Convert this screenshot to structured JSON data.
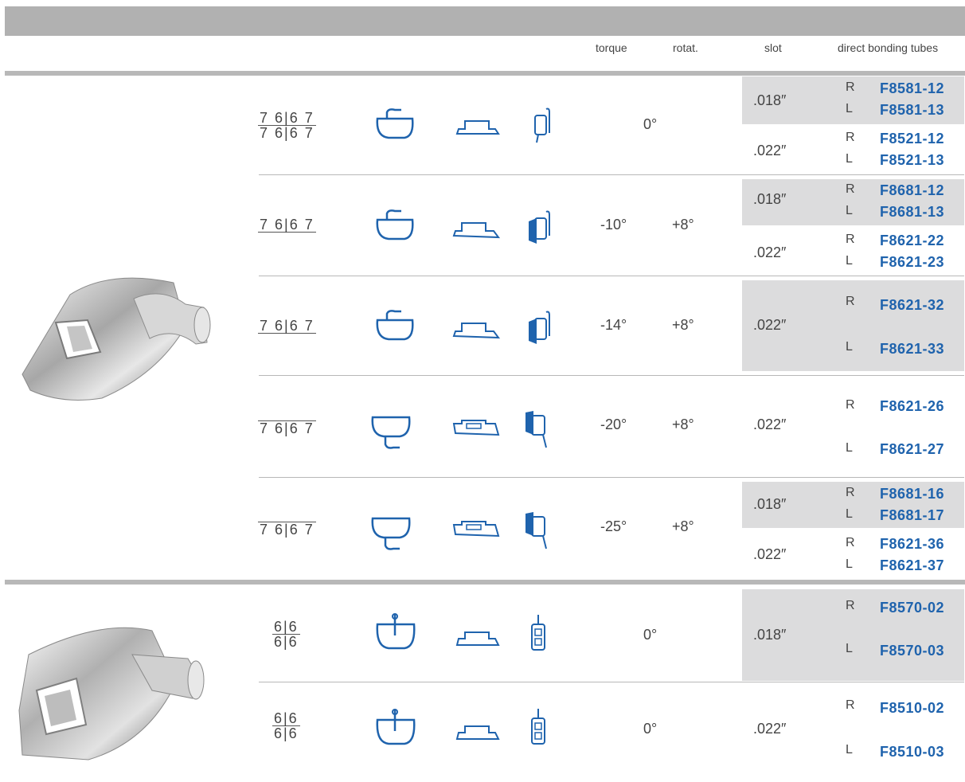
{
  "headers": {
    "torque": "torque",
    "rotat": "rotat.",
    "slot": "slot",
    "tubes": "direct bonding tubes"
  },
  "groups": [
    {
      "rows": [
        {
          "teeth_top": "7 6|6 7",
          "teeth_bottom": "7 6|6 7",
          "torque": "0°",
          "rotation": "",
          "slots": [
            {
              "slot": ".018″",
              "R": "F8581-12",
              "L": "F8581-13"
            },
            {
              "slot": ".022″",
              "R": "F8521-12",
              "L": "F8521-13"
            }
          ]
        },
        {
          "teeth_top": "7 6|6 7",
          "torque": "-10°",
          "rotation": "+8°",
          "slots": [
            {
              "slot": ".018″",
              "R": "F8681-12",
              "L": "F8681-13"
            },
            {
              "slot": ".022″",
              "R": "F8621-22",
              "L": "F8621-23"
            }
          ]
        },
        {
          "teeth_top": "7 6|6 7",
          "torque": "-14°",
          "rotation": "+8°",
          "slots": [
            {
              "slot": ".022″",
              "R": "F8621-32",
              "L": "F8621-33"
            }
          ]
        },
        {
          "teeth_top": "7 6|6 7",
          "torque": "-20°",
          "rotation": "+8°",
          "slots": [
            {
              "slot": ".022″",
              "R": "F8621-26",
              "L": "F8621-27"
            }
          ]
        },
        {
          "teeth_top": "7 6|6 7",
          "torque": "-25°",
          "rotation": "+8°",
          "slots": [
            {
              "slot": ".018″",
              "R": "F8681-16",
              "L": "F8681-17"
            },
            {
              "slot": ".022″",
              "R": "F8621-36",
              "L": "F8621-37"
            }
          ]
        }
      ]
    },
    {
      "rows": [
        {
          "teeth_top": "6|6",
          "teeth_bottom": "6|6",
          "torque": "0°",
          "slots": [
            {
              "slot": ".018″",
              "R": "F8570-02",
              "L": "F8570-03"
            }
          ]
        },
        {
          "teeth_top": "6|6",
          "teeth_bottom": "6|6",
          "torque": "0°",
          "slots": [
            {
              "slot": ".022″",
              "R": "F8510-02",
              "L": "F8510-03"
            }
          ]
        }
      ]
    }
  ],
  "labels": {
    "R": "R",
    "L": "L"
  },
  "colors": {
    "code": "#1f63ad",
    "icon": "#1f63ad",
    "shade": "#dcdcdd",
    "bar": "#b1b1b1"
  }
}
